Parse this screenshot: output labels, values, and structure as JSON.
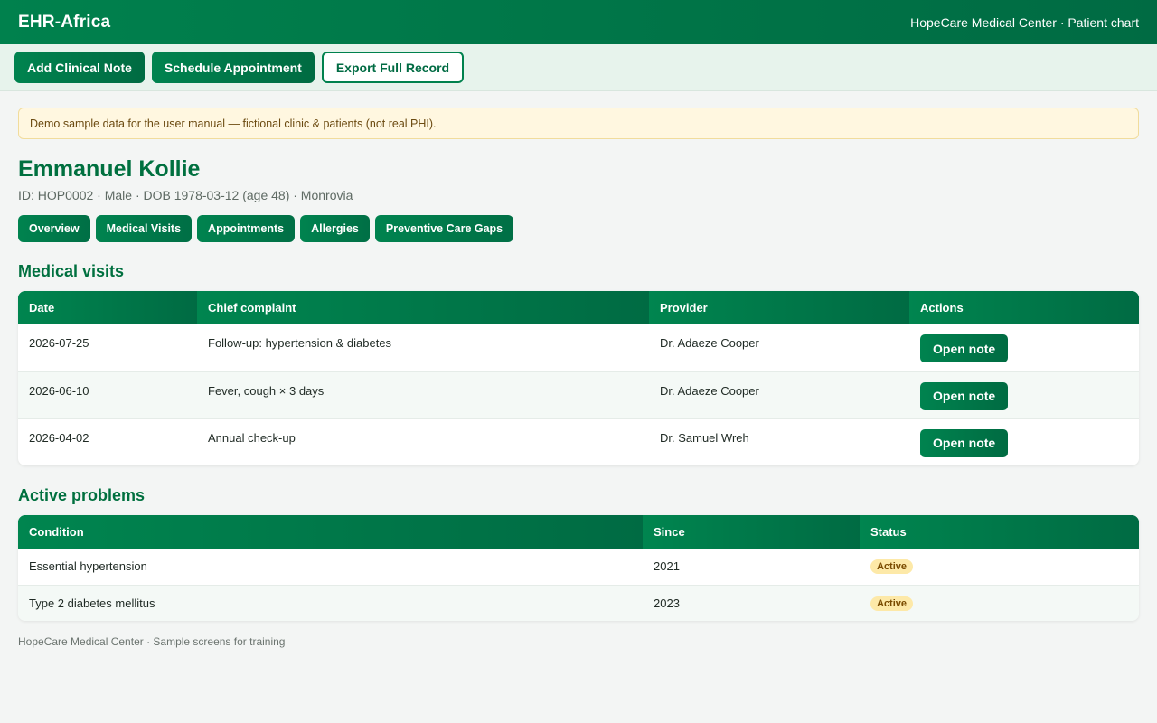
{
  "header": {
    "brand": "EHR-Africa",
    "context": "HopeCare Medical Center · Patient chart"
  },
  "actions": {
    "add_note": "Add Clinical Note",
    "schedule": "Schedule Appointment",
    "export": "Export Full Record"
  },
  "notice": "Demo sample data for the user manual — fictional clinic & patients (not real PHI).",
  "patient": {
    "name": "Emmanuel Kollie",
    "meta": "ID: HOP0002 · Male · DOB 1978-03-12 (age 48) · Monrovia"
  },
  "tabs": [
    "Overview",
    "Medical Visits",
    "Appointments",
    "Allergies",
    "Preventive Care Gaps"
  ],
  "visits": {
    "title": "Medical visits",
    "columns": [
      "Date",
      "Chief complaint",
      "Provider",
      "Actions"
    ],
    "rows": [
      {
        "date": "2026-07-25",
        "complaint": "Follow-up: hypertension & diabetes",
        "provider": "Dr. Adaeze Cooper",
        "action": "Open note"
      },
      {
        "date": "2026-06-10",
        "complaint": "Fever, cough × 3 days",
        "provider": "Dr. Adaeze Cooper",
        "action": "Open note"
      },
      {
        "date": "2026-04-02",
        "complaint": "Annual check-up",
        "provider": "Dr. Samuel Wreh",
        "action": "Open note"
      }
    ]
  },
  "problems": {
    "title": "Active problems",
    "columns": [
      "Condition",
      "Since",
      "Status"
    ],
    "rows": [
      {
        "condition": "Essential hypertension",
        "since": "2021",
        "status": "Active"
      },
      {
        "condition": "Type 2 diabetes mellitus",
        "since": "2023",
        "status": "Active"
      }
    ]
  },
  "footer": "HopeCare Medical Center · Sample screens for training",
  "colors": {
    "primary": "#00814d",
    "primary_dark": "#006b43",
    "badge_bg": "#fde9a8",
    "notice_bg": "#fff7e0"
  }
}
